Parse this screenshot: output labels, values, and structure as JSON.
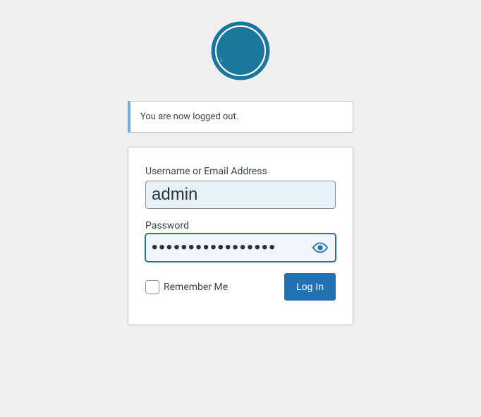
{
  "colors": {
    "brand": "#2271b1",
    "logo": "#1b769c"
  },
  "message": {
    "text": "You are now logged out."
  },
  "form": {
    "username": {
      "label": "Username or Email Address",
      "value": "admin"
    },
    "password": {
      "label": "Password",
      "value": "•••••••••••••••••"
    },
    "remember": {
      "label": "Remember Me"
    },
    "submit": {
      "label": "Log In"
    }
  }
}
